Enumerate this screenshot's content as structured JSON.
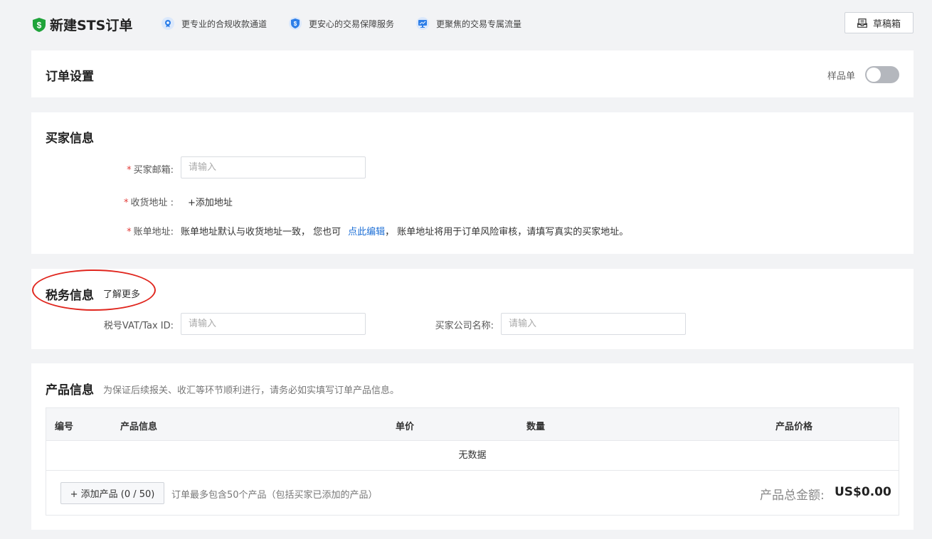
{
  "header": {
    "title": "新建STS订单",
    "features": [
      {
        "label": "更专业的合规收款通道"
      },
      {
        "label": "更安心的交易保障服务"
      },
      {
        "label": "更聚焦的交易专属流量"
      }
    ],
    "draft_label": "草稿箱"
  },
  "order_settings": {
    "title": "订单设置",
    "sample_label": "样品单",
    "sample_enabled": false
  },
  "buyer": {
    "title": "买家信息",
    "email_label": "买家邮箱:",
    "email_placeholder": "请输入",
    "address_label": "收货地址 :",
    "add_address": "+添加地址",
    "billing_label": "账单地址:",
    "billing_text_1": "账单地址默认与收货地址一致， 您也可",
    "billing_link": "点此编辑",
    "billing_text_2": "， 账单地址将用于订单风险审核，请填写真实的买家地址。"
  },
  "tax": {
    "title": "税务信息",
    "learn_more": "了解更多",
    "vat_label": "税号VAT/Tax ID:",
    "vat_placeholder": "请输入",
    "company_label": "买家公司名称:",
    "company_placeholder": "请输入"
  },
  "products": {
    "title": "产品信息",
    "hint": "为保证后续报关、收汇等环节顺利进行，请务必如实填写订单产品信息。",
    "columns": {
      "id": "编号",
      "info": "产品信息",
      "unit_price": "单价",
      "quantity": "数量",
      "price": "产品价格"
    },
    "empty_text": "无数据",
    "add_button": "+ 添加产品 (0 / 50)",
    "limit_note": "订单最多包含50个产品（包括买家已添加的产品）",
    "total_label": "产品总金额:",
    "total_value": "US$0.00"
  },
  "colors": {
    "brand_green": "#1fa33a",
    "link_blue": "#1d6fd6",
    "required_red": "#e23c39",
    "annotation_red": "#e0261e"
  }
}
